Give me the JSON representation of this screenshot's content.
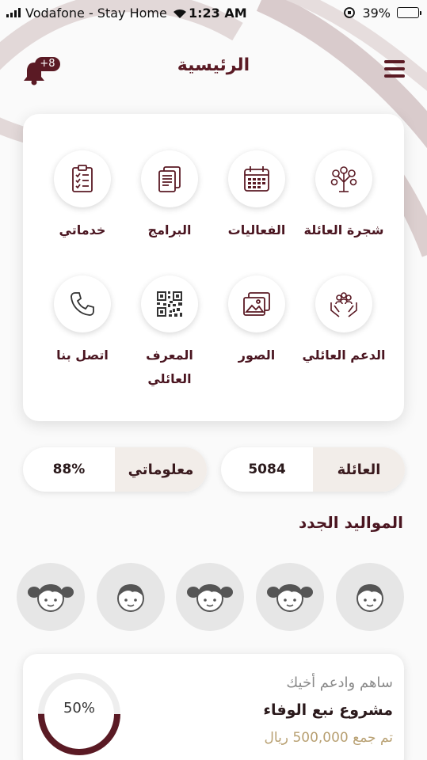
{
  "status_bar": {
    "carrier": "Vodafone - Stay Home",
    "time": "1:23 AM",
    "battery": "39%",
    "battery_level": 0.39
  },
  "header": {
    "title": "الرئيسية",
    "notifications_badge": "+8",
    "menu_icon": "hamburger-menu-icon",
    "bell_icon": "bell-icon"
  },
  "services": [
    {
      "label": "شجرة العائلة",
      "icon": "family-tree-icon"
    },
    {
      "label": "الفعاليات",
      "icon": "calendar-icon"
    },
    {
      "label": "البرامج",
      "icon": "documents-icon"
    },
    {
      "label": "خدماتي",
      "icon": "checklist-icon"
    },
    {
      "label": "الدعم العائلي",
      "icon": "family-support-icon"
    },
    {
      "label": "الصور",
      "icon": "photos-icon"
    },
    {
      "label": "المعرف العائلي",
      "icon": "qr-code-icon"
    },
    {
      "label": "اتصل بنا",
      "icon": "phone-icon"
    }
  ],
  "stats": {
    "family": {
      "label": "العائلة",
      "value": "5084"
    },
    "my_info": {
      "label": "معلوماتي",
      "value": "88%"
    }
  },
  "newborns": {
    "title": "المواليد الجدد",
    "items": [
      {
        "type": "boy",
        "icon": "boy-avatar-icon"
      },
      {
        "type": "girl",
        "icon": "girl-avatar-icon"
      },
      {
        "type": "girl",
        "icon": "girl-avatar-icon"
      },
      {
        "type": "boy",
        "icon": "boy-avatar-icon"
      },
      {
        "type": "girl",
        "icon": "girl-avatar-icon"
      }
    ]
  },
  "project": {
    "subtitle": "ساهم وادعم أخيك",
    "title": "مشروع نبع الوفاء",
    "raised": "تم جمع 500,000 ريال",
    "progress_text": "50%",
    "progress": 0.5
  },
  "colors": {
    "primary": "#5a1a24",
    "accent_gold": "#b8a072",
    "avatar_bg": "#e6e6e6"
  }
}
